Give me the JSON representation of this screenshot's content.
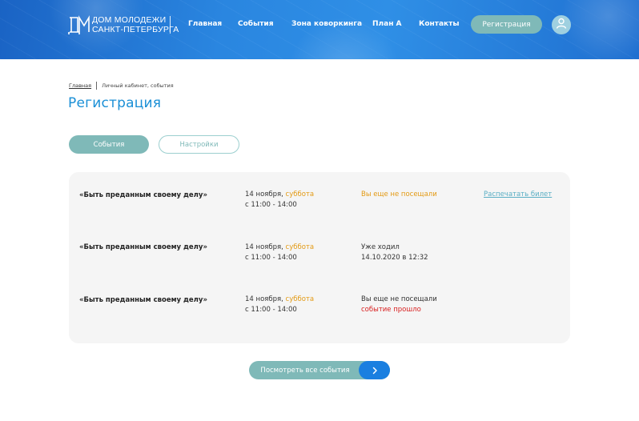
{
  "header": {
    "logo_line1": "ДОМ МОЛОДЕЖИ",
    "logo_line2": "САНКТ-ПЕТЕРБУРГА",
    "nav": [
      "Главная",
      "События",
      "Зона коворкинга",
      "План А",
      "Контакты"
    ],
    "register_label": "Регистрация",
    "avatar_icon": "user-icon"
  },
  "breadcrumb": {
    "home": "Главная",
    "current": "Личный кабинет, события"
  },
  "page_title": "Регистрация",
  "tabs": [
    {
      "label": "События",
      "active": true
    },
    {
      "label": "Настройки",
      "active": false
    }
  ],
  "events": [
    {
      "title": "«Быть преданным своему делу»",
      "date": "14 ноября,",
      "weekday": "суббота",
      "time": "с 11:00 - 14:00",
      "status_line1": "Вы еще не посещали",
      "status_line2": "",
      "action": "Распечатать билет"
    },
    {
      "title": "«Быть преданным своему делу»",
      "date": "14 ноября,",
      "weekday": "суббота",
      "time": "с 11:00 - 14:00",
      "status_line1": "Уже ходил",
      "status_line2": "14.10.2020  в 12:32",
      "action": ""
    },
    {
      "title": "«Быть преданным своему делу»",
      "date": "14 ноября,",
      "weekday": "суббота",
      "time": "с 11:00 - 14:00",
      "status_line1": "Вы еще не посещали",
      "status_line2": "событие прошло",
      "action": ""
    }
  ],
  "view_all_label": "Посмотреть все события",
  "colors": {
    "accent": "#1a8fd6",
    "teal": "#7fb9b8",
    "orange": "#e39a14",
    "red": "#d82020",
    "blue_button": "#1a7fe0"
  }
}
